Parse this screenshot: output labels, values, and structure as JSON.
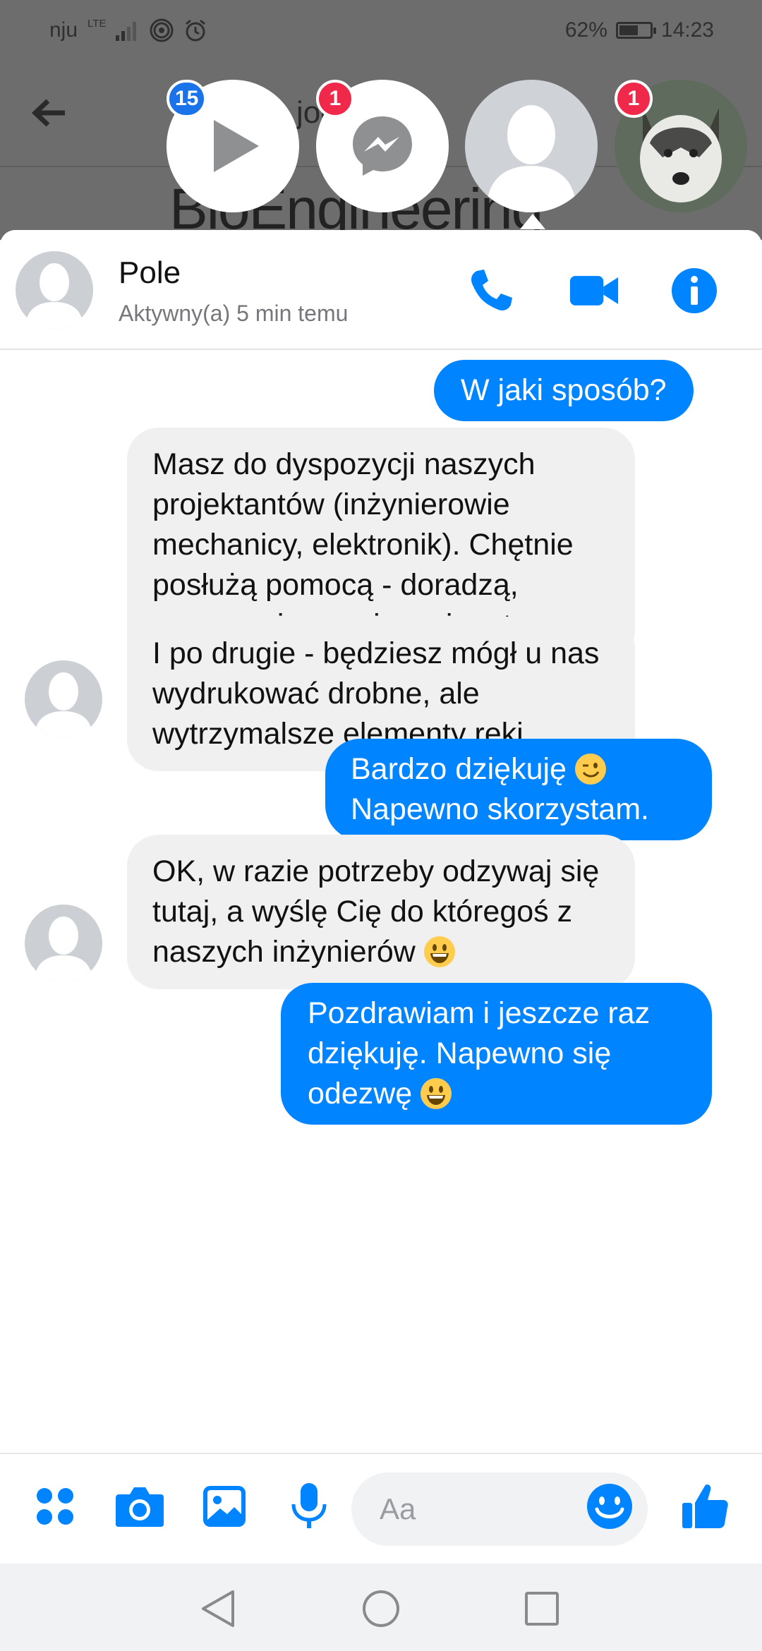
{
  "status_bar": {
    "carrier": "nju",
    "network": "LTE",
    "battery": "62%",
    "battery_level": 0.62,
    "time": "14:23"
  },
  "background_app": {
    "title_fragment": "joe  rin",
    "banner_fragment": "BioEngineering"
  },
  "chat_heads": [
    {
      "name": "video",
      "badge": "15",
      "badge_color": "#1a73e8"
    },
    {
      "name": "messenger",
      "badge": "1",
      "badge_color": "#f02849"
    },
    {
      "name": "pole",
      "badge": ""
    },
    {
      "name": "husky",
      "badge": "1",
      "badge_color": "#f02849"
    }
  ],
  "chat": {
    "contact_name": "Pole",
    "contact_status": "Aktywny(a) 5 min temu",
    "accent": "#0084ff",
    "messages": [
      {
        "from": "me",
        "text": "W jaki sposób?"
      },
      {
        "from": "them",
        "text": "Masz do dyspozycji naszych projektantów (inżynierowie mechanicy, elektronik). Chętnie  posłużą pomocą - doradzą, zasugerują rozwiązania, etc."
      },
      {
        "from": "them",
        "text": "I po drugie - będziesz mógł u nas wydrukować drobne, ale wytrzymalsze elementy ręki"
      },
      {
        "from": "me",
        "text": "Bardzo dziękuję",
        "text2": "Napewno skorzystam.",
        "emoji": "wink"
      },
      {
        "from": "them",
        "text": "OK, w razie potrzeby odzywaj się tutaj, a wyślę Cię do któregoś z naszych inżynierów",
        "emoji": "grin"
      },
      {
        "from": "me",
        "text": "Pozdrawiam i jeszcze raz dziękuję. Napewno się odezwę",
        "emoji": "grin"
      }
    ]
  },
  "composer": {
    "placeholder": "Aa"
  },
  "icons": [
    "back-arrow-icon",
    "phone-icon",
    "video-camera-icon",
    "info-icon",
    "apps-icon",
    "camera-icon",
    "gallery-icon",
    "microphone-icon",
    "emoji-icon",
    "like-icon",
    "back-icon",
    "home-icon",
    "recents-icon"
  ]
}
